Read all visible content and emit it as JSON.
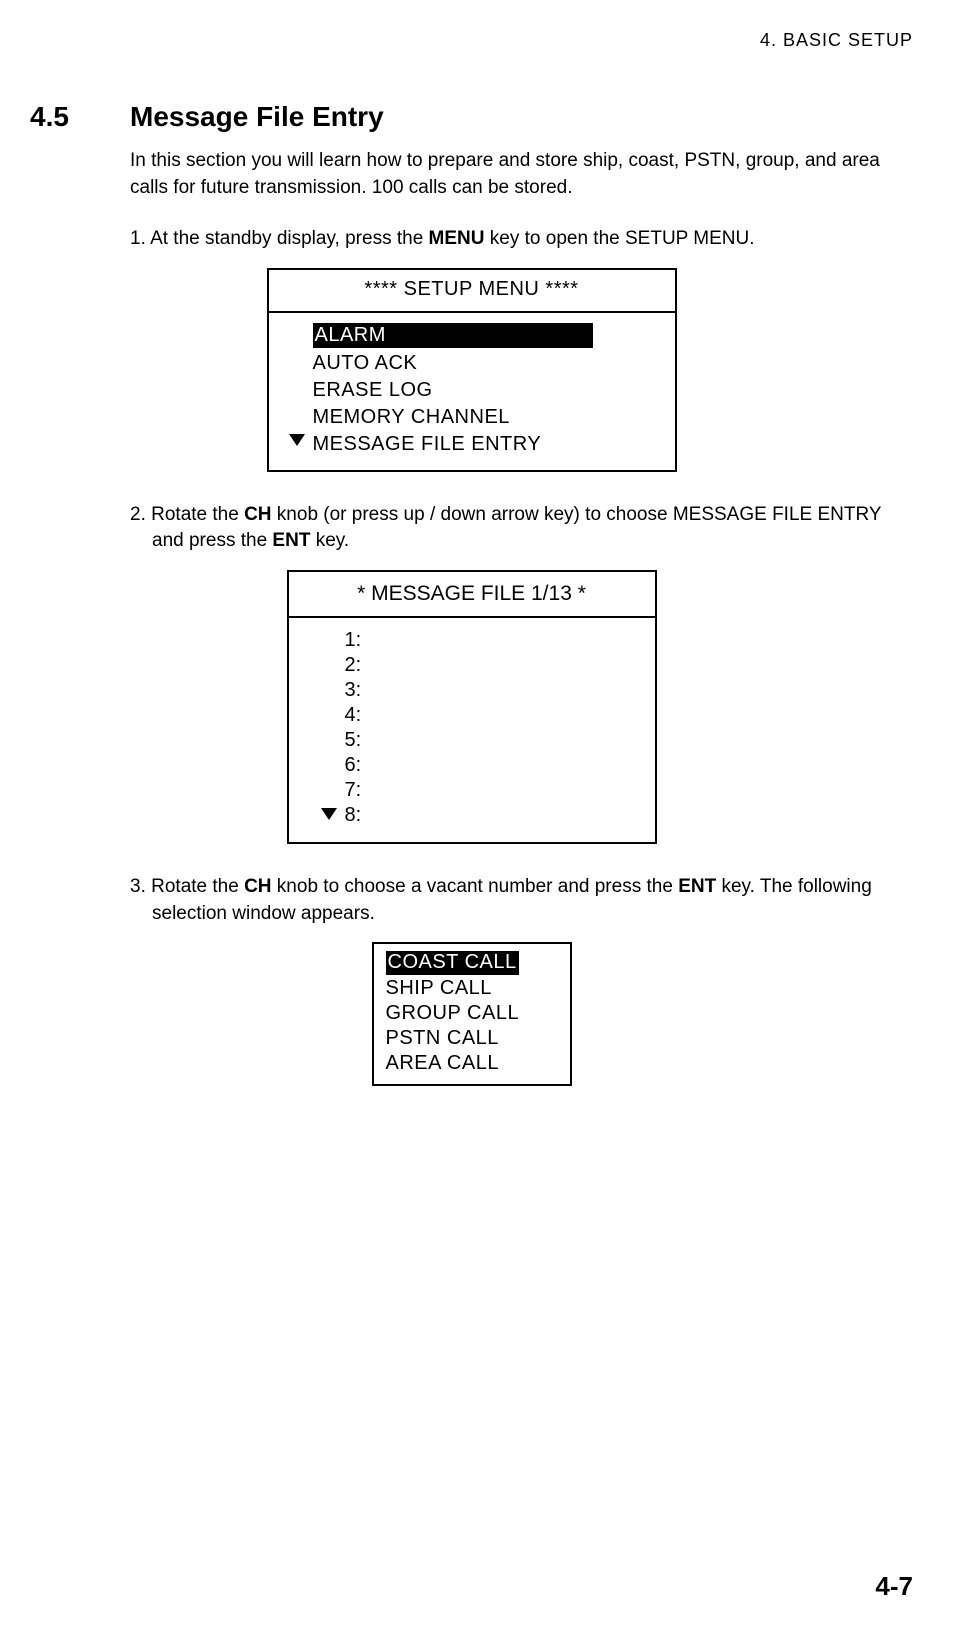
{
  "header": {
    "chapter": "4.  BASIC  SETUP"
  },
  "section": {
    "number": "4.5",
    "title": "Message File Entry"
  },
  "intro": "In this section you will learn how to prepare and store ship, coast, PSTN, group, and area calls for future transmission. 100 calls can be stored.",
  "step1": {
    "prefix": "1. At the standby display, press the ",
    "bold1": "MENU",
    "suffix": " key to open the SETUP MENU."
  },
  "setup_menu": {
    "title": "**** SETUP MENU ****",
    "items": [
      {
        "label": "ALARM",
        "selected": true,
        "arrow": false
      },
      {
        "label": "AUTO  ACK",
        "selected": false,
        "arrow": false
      },
      {
        "label": "ERASE  LOG",
        "selected": false,
        "arrow": false
      },
      {
        "label": "MEMORY CHANNEL",
        "selected": false,
        "arrow": false
      },
      {
        "label": "MESSAGE FILE ENTRY",
        "selected": false,
        "arrow": true
      }
    ]
  },
  "step2": {
    "prefix": "2. Rotate the ",
    "bold1": "CH",
    "mid": " knob (or press up / down arrow key) to choose MESSAGE FILE ENTRY and press the ",
    "bold2": "ENT",
    "suffix": " key."
  },
  "message_file": {
    "title": "* MESSAGE FILE 1/13 *",
    "lines": [
      {
        "label": "1:",
        "arrow": false
      },
      {
        "label": "2:",
        "arrow": false
      },
      {
        "label": "3:",
        "arrow": false
      },
      {
        "label": "4:",
        "arrow": false
      },
      {
        "label": "5:",
        "arrow": false
      },
      {
        "label": "6:",
        "arrow": false
      },
      {
        "label": "7:",
        "arrow": false
      },
      {
        "label": "8:",
        "arrow": true
      }
    ]
  },
  "step3": {
    "prefix": "3. Rotate the ",
    "bold1": "CH",
    "mid": " knob to choose a vacant number and press the ",
    "bold2": "ENT",
    "suffix": " key. The following selection window appears."
  },
  "call_menu": {
    "items": [
      {
        "label": "COAST CALL",
        "selected": true
      },
      {
        "label": "SHIP CALL",
        "selected": false
      },
      {
        "label": "GROUP CALL",
        "selected": false
      },
      {
        "label": "PSTN CALL",
        "selected": false
      },
      {
        "label": "AREA CALL",
        "selected": false
      }
    ]
  },
  "page_number": "4-7"
}
